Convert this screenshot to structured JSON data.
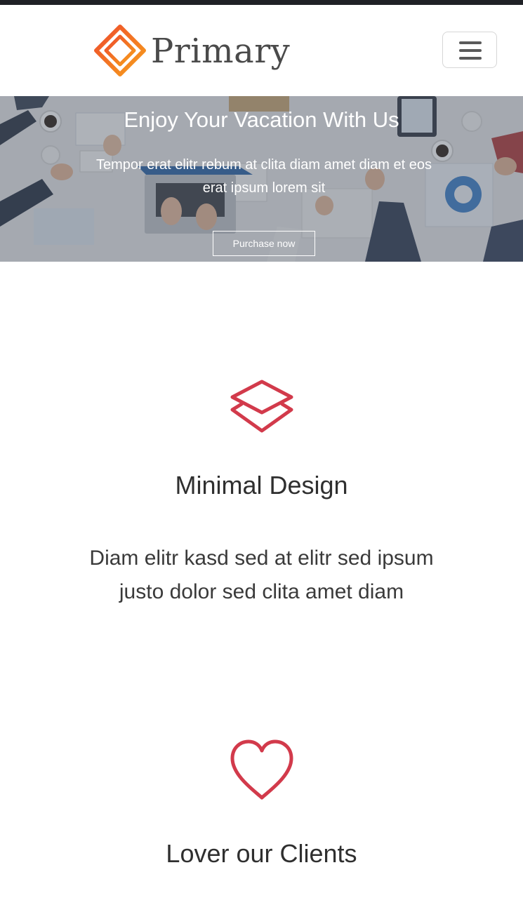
{
  "header": {
    "brand_name": "Primary",
    "logo_icon": "diamond-logo-icon",
    "menu_icon": "hamburger-menu-icon",
    "colors": {
      "top_strip": "#1f2126",
      "logo_gradient_start": "#f0592a",
      "logo_gradient_end": "#f7a01b",
      "brand_text": "#4a4a4a"
    }
  },
  "hero": {
    "title": "Enjoy Your Vacation With Us",
    "subtitle": "Tempor erat elitr rebum at clita diam amet diam et eos erat ipsum lorem sit",
    "button_label": "Purchase now",
    "background_image": "office-teamwork-photo"
  },
  "features": [
    {
      "icon": "layers-icon",
      "title": "Minimal Design",
      "text": "Diam elitr kasd sed at elitr sed ipsum justo dolor sed clita amet diam"
    },
    {
      "icon": "heart-icon",
      "title": "Lover our Clients"
    }
  ],
  "accent_color": "#d23a4b"
}
